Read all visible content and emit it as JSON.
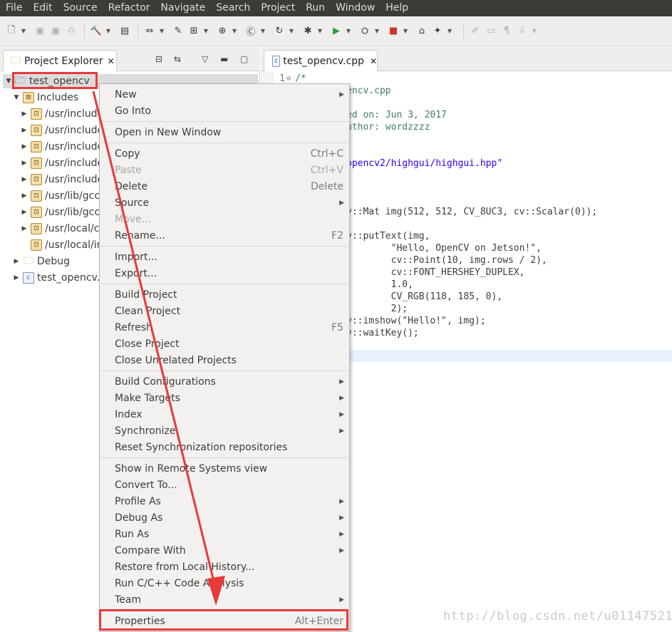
{
  "menubar": [
    "File",
    "Edit",
    "Source",
    "Refactor",
    "Navigate",
    "Search",
    "Project",
    "Run",
    "Window",
    "Help"
  ],
  "project_explorer": {
    "title": "Project Explorer",
    "tree": {
      "project": "test_opencv",
      "includes": "Includes",
      "include_paths": [
        "/usr/include",
        "/usr/include",
        "/usr/include",
        "/usr/include",
        "/usr/include",
        "/usr/lib/gcc",
        "/usr/lib/gcc",
        "/usr/local/c",
        "/usr/local/in"
      ],
      "debug": "Debug",
      "source_file": "test_opencv.c"
    }
  },
  "editor": {
    "tab": "test_opencv.cpp",
    "first_line_number": "1",
    "lines": [
      "/*",
      "encv.cpp",
      "",
      "ed on: Jun 3, 2017",
      "uthor: wordzzzz",
      "",
      "",
      "opencv2/highgui/highgui.hpp\"",
      "",
      "",
      "",
      "v::Mat img(512, 512, CV_8UC3, cv::Scalar(0));",
      "",
      "v::putText(img,",
      "        \"Hello, OpenCV on Jetson!\",",
      "        cv::Point(10, img.rows / 2),",
      "        cv::FONT_HERSHEY_DUPLEX,",
      "        1.0,",
      "        CV_RGB(118, 185, 0),",
      "        2);",
      "v::imshow(\"Hello!\", img);",
      "v::waitKey();"
    ]
  },
  "context_menu": {
    "items": [
      {
        "label": "New",
        "submenu": true
      },
      {
        "label": "Go Into"
      },
      {
        "sep": true
      },
      {
        "label": "Open in New Window"
      },
      {
        "sep": true
      },
      {
        "label": "Copy",
        "accel": "Ctrl+C"
      },
      {
        "label": "Paste",
        "accel": "Ctrl+V",
        "disabled": true
      },
      {
        "label": "Delete",
        "accel": "Delete"
      },
      {
        "label": "Source",
        "submenu": true
      },
      {
        "label": "Move...",
        "disabled": true
      },
      {
        "label": "Rename...",
        "accel": "F2"
      },
      {
        "sep": true
      },
      {
        "label": "Import..."
      },
      {
        "label": "Export..."
      },
      {
        "sep": true
      },
      {
        "label": "Build Project"
      },
      {
        "label": "Clean Project"
      },
      {
        "label": "Refresh",
        "accel": "F5"
      },
      {
        "label": "Close Project"
      },
      {
        "label": "Close Unrelated Projects"
      },
      {
        "sep": true
      },
      {
        "label": "Build Configurations",
        "submenu": true
      },
      {
        "label": "Make Targets",
        "submenu": true
      },
      {
        "label": "Index",
        "submenu": true
      },
      {
        "label": "Synchronize",
        "submenu": true
      },
      {
        "label": "Reset Synchronization repositories"
      },
      {
        "sep": true
      },
      {
        "label": "Show in Remote Systems view"
      },
      {
        "label": "Convert To..."
      },
      {
        "label": "Profile As",
        "submenu": true
      },
      {
        "label": "Debug As",
        "submenu": true
      },
      {
        "label": "Run As",
        "submenu": true
      },
      {
        "label": "Compare With",
        "submenu": true
      },
      {
        "label": "Restore from Local History..."
      },
      {
        "label": "Run C/C++ Code Analysis"
      },
      {
        "label": "Team",
        "submenu": true
      },
      {
        "sep": true
      },
      {
        "label": "Properties",
        "accel": "Alt+Enter"
      }
    ]
  },
  "watermark": "http://blog.csdn.net/u011475210",
  "colors": {
    "highlight": "#e8393a",
    "menubar_bg": "#3c3b37"
  }
}
